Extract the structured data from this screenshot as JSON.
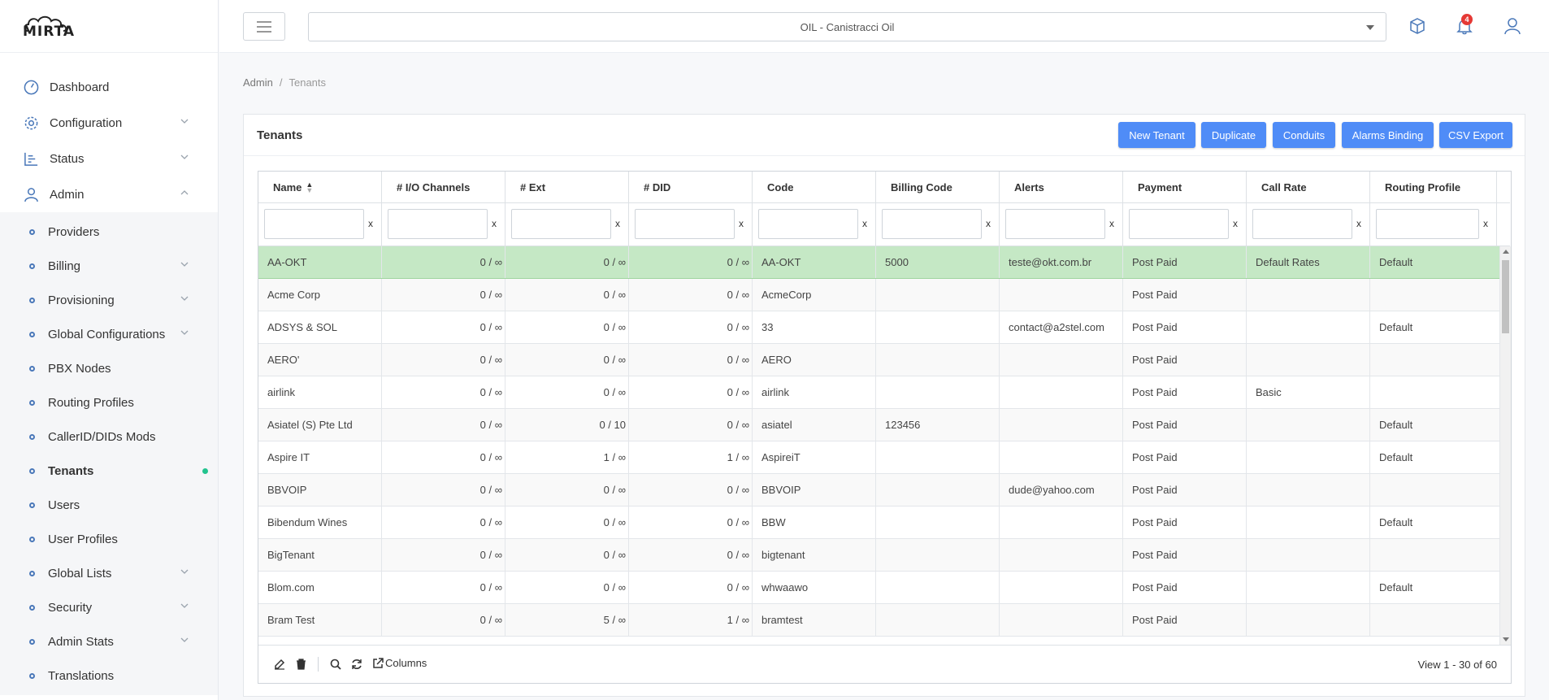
{
  "app": {
    "logo_text": "MIRTA"
  },
  "sidebar": {
    "items": [
      {
        "label": "Dashboard",
        "icon": "dashboard-icon"
      },
      {
        "label": "Configuration",
        "icon": "gear-icon"
      },
      {
        "label": "Status",
        "icon": "chart-icon"
      },
      {
        "label": "Admin",
        "icon": "user-icon"
      }
    ],
    "admin_sub": [
      {
        "label": "Providers"
      },
      {
        "label": "Billing"
      },
      {
        "label": "Provisioning"
      },
      {
        "label": "Global Configurations"
      },
      {
        "label": "PBX Nodes"
      },
      {
        "label": "Routing Profiles"
      },
      {
        "label": "CallerID/DIDs Mods"
      },
      {
        "label": "Tenants"
      },
      {
        "label": "Users"
      },
      {
        "label": "User Profiles"
      },
      {
        "label": "Global Lists"
      },
      {
        "label": "Security"
      },
      {
        "label": "Admin Stats"
      },
      {
        "label": "Translations"
      }
    ]
  },
  "topbar": {
    "tenant_select_value": "OIL - Canistracci Oil",
    "notification_count": "4"
  },
  "breadcrumb": {
    "root": "Admin",
    "separator": "/",
    "current": "Tenants"
  },
  "card": {
    "title": "Tenants",
    "buttons": {
      "new_tenant": "New Tenant",
      "duplicate": "Duplicate",
      "conduits": "Conduits",
      "alarms_binding": "Alarms Binding",
      "csv_export": "CSV Export"
    }
  },
  "grid": {
    "columns": [
      "Name",
      "# I/O Channels",
      "# Ext",
      "# DID",
      "Code",
      "Billing Code",
      "Alerts",
      "Payment",
      "Call Rate",
      "Routing Profile"
    ],
    "filter_clear": "x",
    "rows": [
      [
        "AA-OKT",
        "0 / ∞",
        "0 / ∞",
        "0 / ∞",
        "AA-OKT",
        "5000",
        "teste@okt.com.br",
        "Post Paid",
        "Default Rates",
        "Default"
      ],
      [
        "Acme Corp",
        "0 / ∞",
        "0 / ∞",
        "0 / ∞",
        "AcmeCorp",
        "",
        "",
        "Post Paid",
        "",
        ""
      ],
      [
        "ADSYS & SOL",
        "0 / ∞",
        "0 / ∞",
        "0 / ∞",
        "33",
        "",
        "contact@a2stel.com",
        "Post Paid",
        "",
        "Default"
      ],
      [
        "AERO'",
        "0 / ∞",
        "0 / ∞",
        "0 / ∞",
        "AERO",
        "",
        "",
        "Post Paid",
        "",
        ""
      ],
      [
        "airlink",
        "0 / ∞",
        "0 / ∞",
        "0 / ∞",
        "airlink",
        "",
        "",
        "Post Paid",
        "Basic",
        ""
      ],
      [
        "Asiatel (S) Pte Ltd",
        "0 / ∞",
        "0 / 10",
        "0 / ∞",
        "asiatel",
        "123456",
        "",
        "Post Paid",
        "",
        "Default"
      ],
      [
        "Aspire IT",
        "0 / ∞",
        "1 / ∞",
        "1 / ∞",
        "AspireiT",
        "",
        "",
        "Post Paid",
        "",
        "Default"
      ],
      [
        "BBVOIP",
        "0 / ∞",
        "0 / ∞",
        "0 / ∞",
        "BBVOIP",
        "",
        "dude@yahoo.com",
        "Post Paid",
        "",
        ""
      ],
      [
        "Bibendum Wines",
        "0 / ∞",
        "0 / ∞",
        "0 / ∞",
        "BBW",
        "",
        "",
        "Post Paid",
        "",
        "Default"
      ],
      [
        "BigTenant",
        "0 / ∞",
        "0 / ∞",
        "0 / ∞",
        "bigtenant",
        "",
        "",
        "Post Paid",
        "",
        ""
      ],
      [
        "Blom.com",
        "0 / ∞",
        "0 / ∞",
        "0 / ∞",
        "whwaawo",
        "",
        "",
        "Post Paid",
        "",
        "Default"
      ],
      [
        "Bram Test",
        "0 / ∞",
        "5 / ∞",
        "1 / ∞",
        "bramtest",
        "",
        "",
        "Post Paid",
        "",
        ""
      ]
    ],
    "footer": {
      "columns_label": "Columns",
      "pager_info": "View 1 - 30 of 60"
    }
  },
  "colors": {
    "accent": "#4a78b9",
    "button": "#4f8cf7",
    "selected_row": "#c5e8c5",
    "badge": "#e53935",
    "active_indicator": "#22c38e"
  }
}
